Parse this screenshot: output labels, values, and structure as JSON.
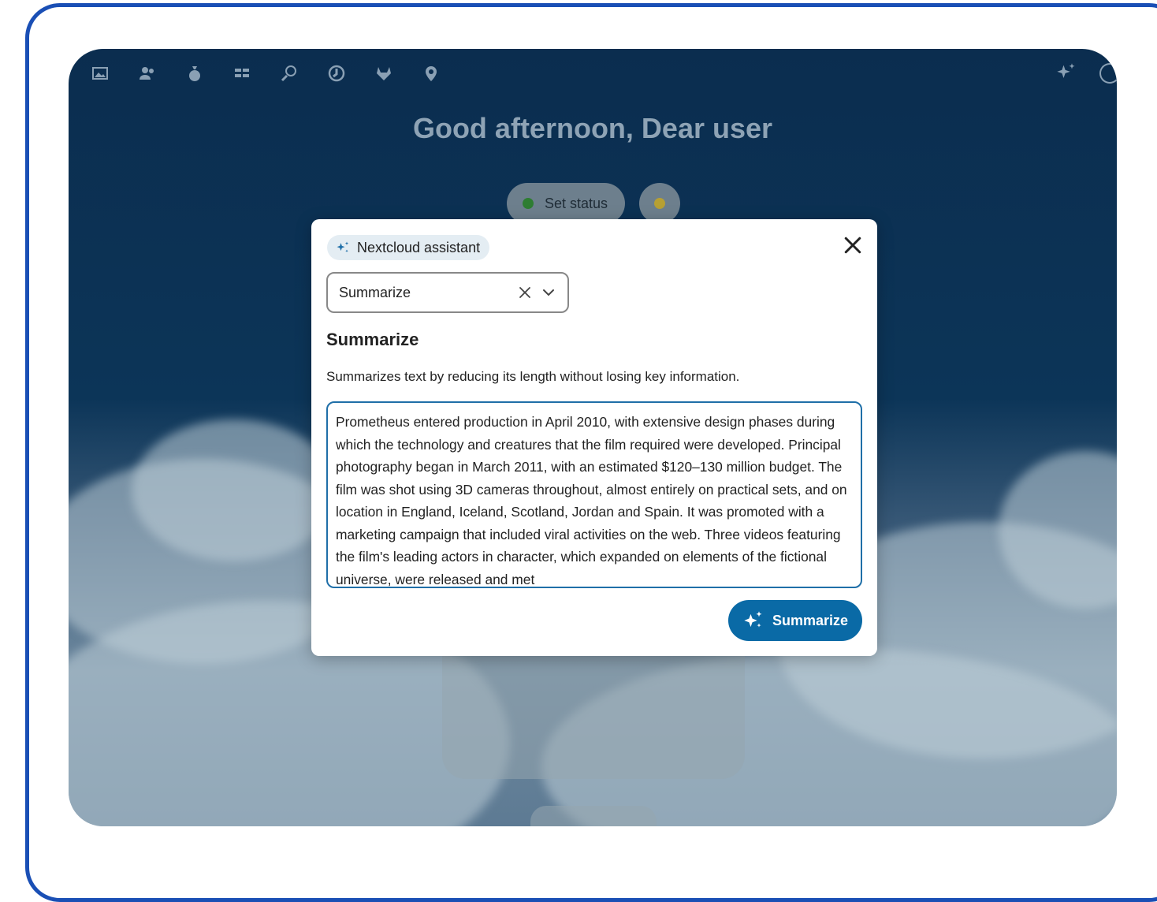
{
  "dashboard": {
    "greeting": "Good afternoon, Dear user",
    "status_label": "Set status",
    "top_icons": [
      "photos-icon",
      "contacts-icon",
      "money-bag-icon",
      "apps-grid-icon",
      "search-people-icon",
      "activity-icon",
      "gitlab-icon",
      "location-icon"
    ],
    "right_icons": [
      "assistant-sparkle-icon",
      "search-icon"
    ]
  },
  "dialog": {
    "assistant_chip": "Nextcloud assistant",
    "task_select": {
      "value": "Summarize"
    },
    "task_title": "Summarize",
    "task_description": "Summarizes text by reducing its length without losing key information.",
    "input_text": "Prometheus entered production in April 2010, with extensive design phases during which the technology and creatures that the film required were developed. Principal photography began in March 2011, with an estimated $120–130 million budget. The film was shot using 3D cameras throughout, almost entirely on practical sets, and on location in England, Iceland, Scotland, Jordan and Spain. It was promoted with a marketing campaign that included viral activities on the web. Three videos featuring the film's leading actors in character, which expanded on elements of the fictional universe, were released and met",
    "submit_label": "Summarize"
  },
  "colors": {
    "frame": "#1a4fb5",
    "accent": "#0a6aa6",
    "background_top": "#0b2d4f"
  }
}
